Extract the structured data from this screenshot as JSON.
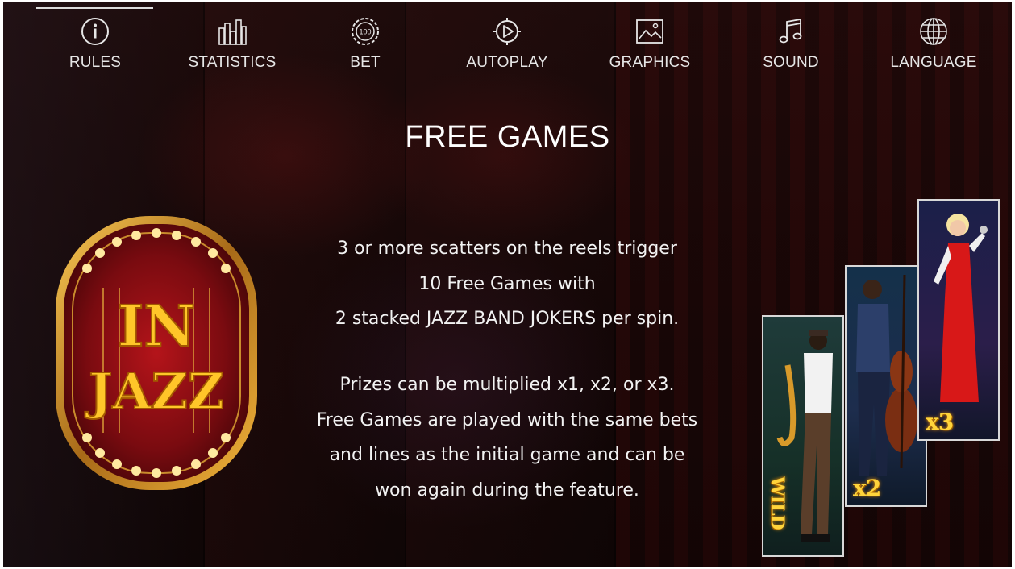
{
  "nav": {
    "items": [
      {
        "label": "RULES",
        "icon": "info-icon"
      },
      {
        "label": "STATISTICS",
        "icon": "bar-chart-icon"
      },
      {
        "label": "BET",
        "icon": "chip-icon"
      },
      {
        "label": "AUTOPLAY",
        "icon": "play-circle-icon"
      },
      {
        "label": "GRAPHICS",
        "icon": "image-icon"
      },
      {
        "label": "SOUND",
        "icon": "music-note-icon"
      },
      {
        "label": "LANGUAGE",
        "icon": "globe-icon"
      }
    ],
    "active": "RULES",
    "chip_text": "100"
  },
  "page": {
    "title": "FREE GAMES",
    "para1": [
      "3 or more scatters on the reels trigger",
      "10 Free Games with",
      "2 stacked JAZZ BAND JOKERS per spin."
    ],
    "para2": [
      "Prizes can be multiplied x1, x2, or x3.",
      "Free Games are played with the same bets",
      "and lines as the initial game and can be",
      "won again during the feature."
    ]
  },
  "logo": {
    "line1": "IN",
    "line2": "JAZZ"
  },
  "symbols": [
    {
      "name": "saxophonist",
      "badge": "WILD"
    },
    {
      "name": "bassist",
      "badge": "x2"
    },
    {
      "name": "singer",
      "badge": "x3"
    }
  ],
  "colors": {
    "gold": "#ffd43b",
    "bulb": "#ffe9a0",
    "text": "#ffffff"
  }
}
